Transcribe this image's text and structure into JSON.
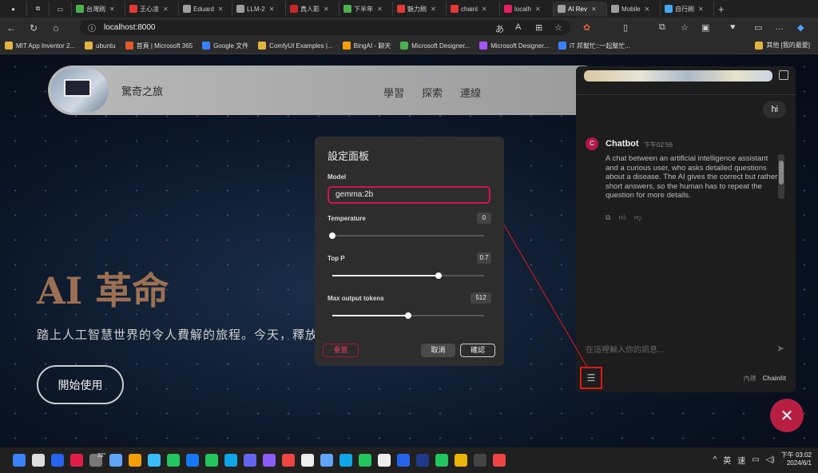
{
  "browser": {
    "tabs": [
      {
        "label": "台灣刷",
        "color": "#4caf50"
      },
      {
        "label": "王心凌",
        "color": "#e53935"
      },
      {
        "label": "Eduard",
        "color": "#9e9e9e"
      },
      {
        "label": "LLM-2",
        "color": "#9e9e9e"
      },
      {
        "label": "真人影",
        "color": "#c62828"
      },
      {
        "label": "下半年",
        "color": "#4caf50"
      },
      {
        "label": "魅力刷",
        "color": "#e53935"
      },
      {
        "label": "chainl",
        "color": "#e53935"
      },
      {
        "label": "localh",
        "color": "#e91e63"
      },
      {
        "label": "AI Rev",
        "color": "#9e9e9e",
        "active": true
      },
      {
        "label": "Mobile",
        "color": "#9e9e9e"
      },
      {
        "label": "自行刷",
        "color": "#42a5f5"
      }
    ],
    "url": "localhost:8000",
    "bookmarks": [
      "MIT App Inventor 2...",
      "ubuntu",
      "首頁 | Microsoft 365",
      "Google 文件",
      "ComfyUI Examples |...",
      "BingAI - 聊天",
      "Microsoft Designer...",
      "Microsoft Designer...",
      "iT 邦幫忙::一起幫忙..."
    ],
    "bookmarks_other": "其他 [我的最愛]"
  },
  "site": {
    "name": "驚奇之旅",
    "nav": [
      "學習",
      "探索",
      "連線"
    ],
    "hero_title": "AI 革命",
    "hero_subtitle": "踏上人工智慧世界的令人費解的旅程。今天，釋放明",
    "cta": "開始使用"
  },
  "chat": {
    "user_message": "hi",
    "bot_name": "Chatbot",
    "bot_time": "下午02:56",
    "bot_message": "A chat between an artificial intelligence assistant and a curious user, who asks detailed questions about a disease. The AI gives the correct but rather short answers, so the human has to repeat the question for more details.",
    "input_placeholder": "在這裡輸入你的訊息...",
    "built_with": "內建",
    "brand": "Chainlit"
  },
  "settings": {
    "title": "設定面板",
    "model_label": "Model",
    "model_value": "gemma:2b",
    "temperature_label": "Temperature",
    "temperature_value": "0",
    "temperature_fraction": 0.0,
    "top_p_label": "Top P",
    "top_p_value": "0.7",
    "top_p_fraction": 0.7,
    "max_tokens_label": "Max output tokens",
    "max_tokens_value": "512",
    "max_tokens_fraction": 0.5,
    "reset_label": "重置",
    "cancel_label": "取消",
    "confirm_label": "確認"
  },
  "taskbar": {
    "weather": "32°",
    "lang": "英",
    "ime": "速",
    "time": "下午 03:02",
    "date": "2024/6/1"
  },
  "colors": {
    "accent": "#d1134d",
    "hero": "#9b7052"
  }
}
